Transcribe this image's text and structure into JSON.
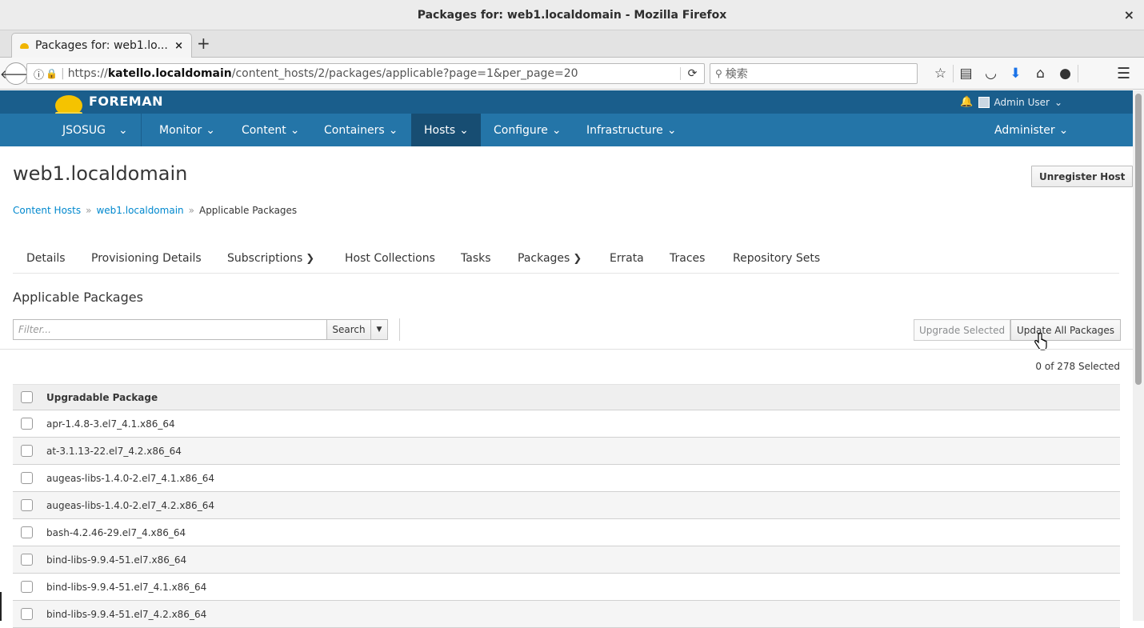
{
  "window": {
    "title": "Packages for: web1.localdomain - Mozilla Firefox",
    "close_glyph": "×"
  },
  "browser": {
    "tab_title": "Packages for: web1.lo...",
    "tab_close": "×",
    "new_tab": "+",
    "url_host": "katello.localdomain",
    "url_prefix": "https://",
    "url_path": "/content_hosts/2/packages/applicable?page=1&per_page=20",
    "search_placeholder": "検索",
    "search_glyph": "🔍"
  },
  "foreman": {
    "brand": "FOREMAN",
    "user": "Admin User",
    "nav": [
      {
        "label": "JSOSUG",
        "caret": "⌄"
      },
      {
        "label": "Monitor",
        "caret": "⌄"
      },
      {
        "label": "Content",
        "caret": "⌄"
      },
      {
        "label": "Containers",
        "caret": "⌄"
      },
      {
        "label": "Hosts",
        "caret": "⌄"
      },
      {
        "label": "Configure",
        "caret": "⌄"
      },
      {
        "label": "Infrastructure",
        "caret": "⌄"
      },
      {
        "label": "Administer",
        "caret": "⌄"
      }
    ],
    "active_nav": "Hosts"
  },
  "page": {
    "title": "web1.localdomain",
    "unregister_label": "Unregister Host",
    "breadcrumb": {
      "item1": "Content Hosts",
      "item2": "web1.localdomain",
      "current": "Applicable Packages",
      "sep": "»"
    },
    "tabs": [
      {
        "label": "Details"
      },
      {
        "label": "Provisioning Details"
      },
      {
        "label": "Subscriptions"
      },
      {
        "label": "Host Collections"
      },
      {
        "label": "Tasks"
      },
      {
        "label": "Packages"
      },
      {
        "label": "Errata"
      },
      {
        "label": "Traces"
      },
      {
        "label": "Repository Sets"
      }
    ],
    "section_title": "Applicable Packages",
    "filter_placeholder": "Filter...",
    "search_label": "Search",
    "upgrade_selected_label": "Upgrade Selected",
    "update_all_label": "Update All Packages",
    "selected_count": "0 of 278 Selected",
    "table_header": "Upgradable Package",
    "packages": [
      "apr-1.4.8-3.el7_4.1.x86_64",
      "at-3.1.13-22.el7_4.2.x86_64",
      "augeas-libs-1.4.0-2.el7_4.1.x86_64",
      "augeas-libs-1.4.0-2.el7_4.2.x86_64",
      "bash-4.2.46-29.el7_4.x86_64",
      "bind-libs-9.9.4-51.el7.x86_64",
      "bind-libs-9.9.4-51.el7_4.1.x86_64",
      "bind-libs-9.9.4-51.el7_4.2.x86_64"
    ]
  },
  "colors": {
    "foreman_top": "#1a5e8c",
    "foreman_nav": "#2475a8",
    "foreman_nav_active": "#174d72",
    "link": "#0088ce"
  }
}
